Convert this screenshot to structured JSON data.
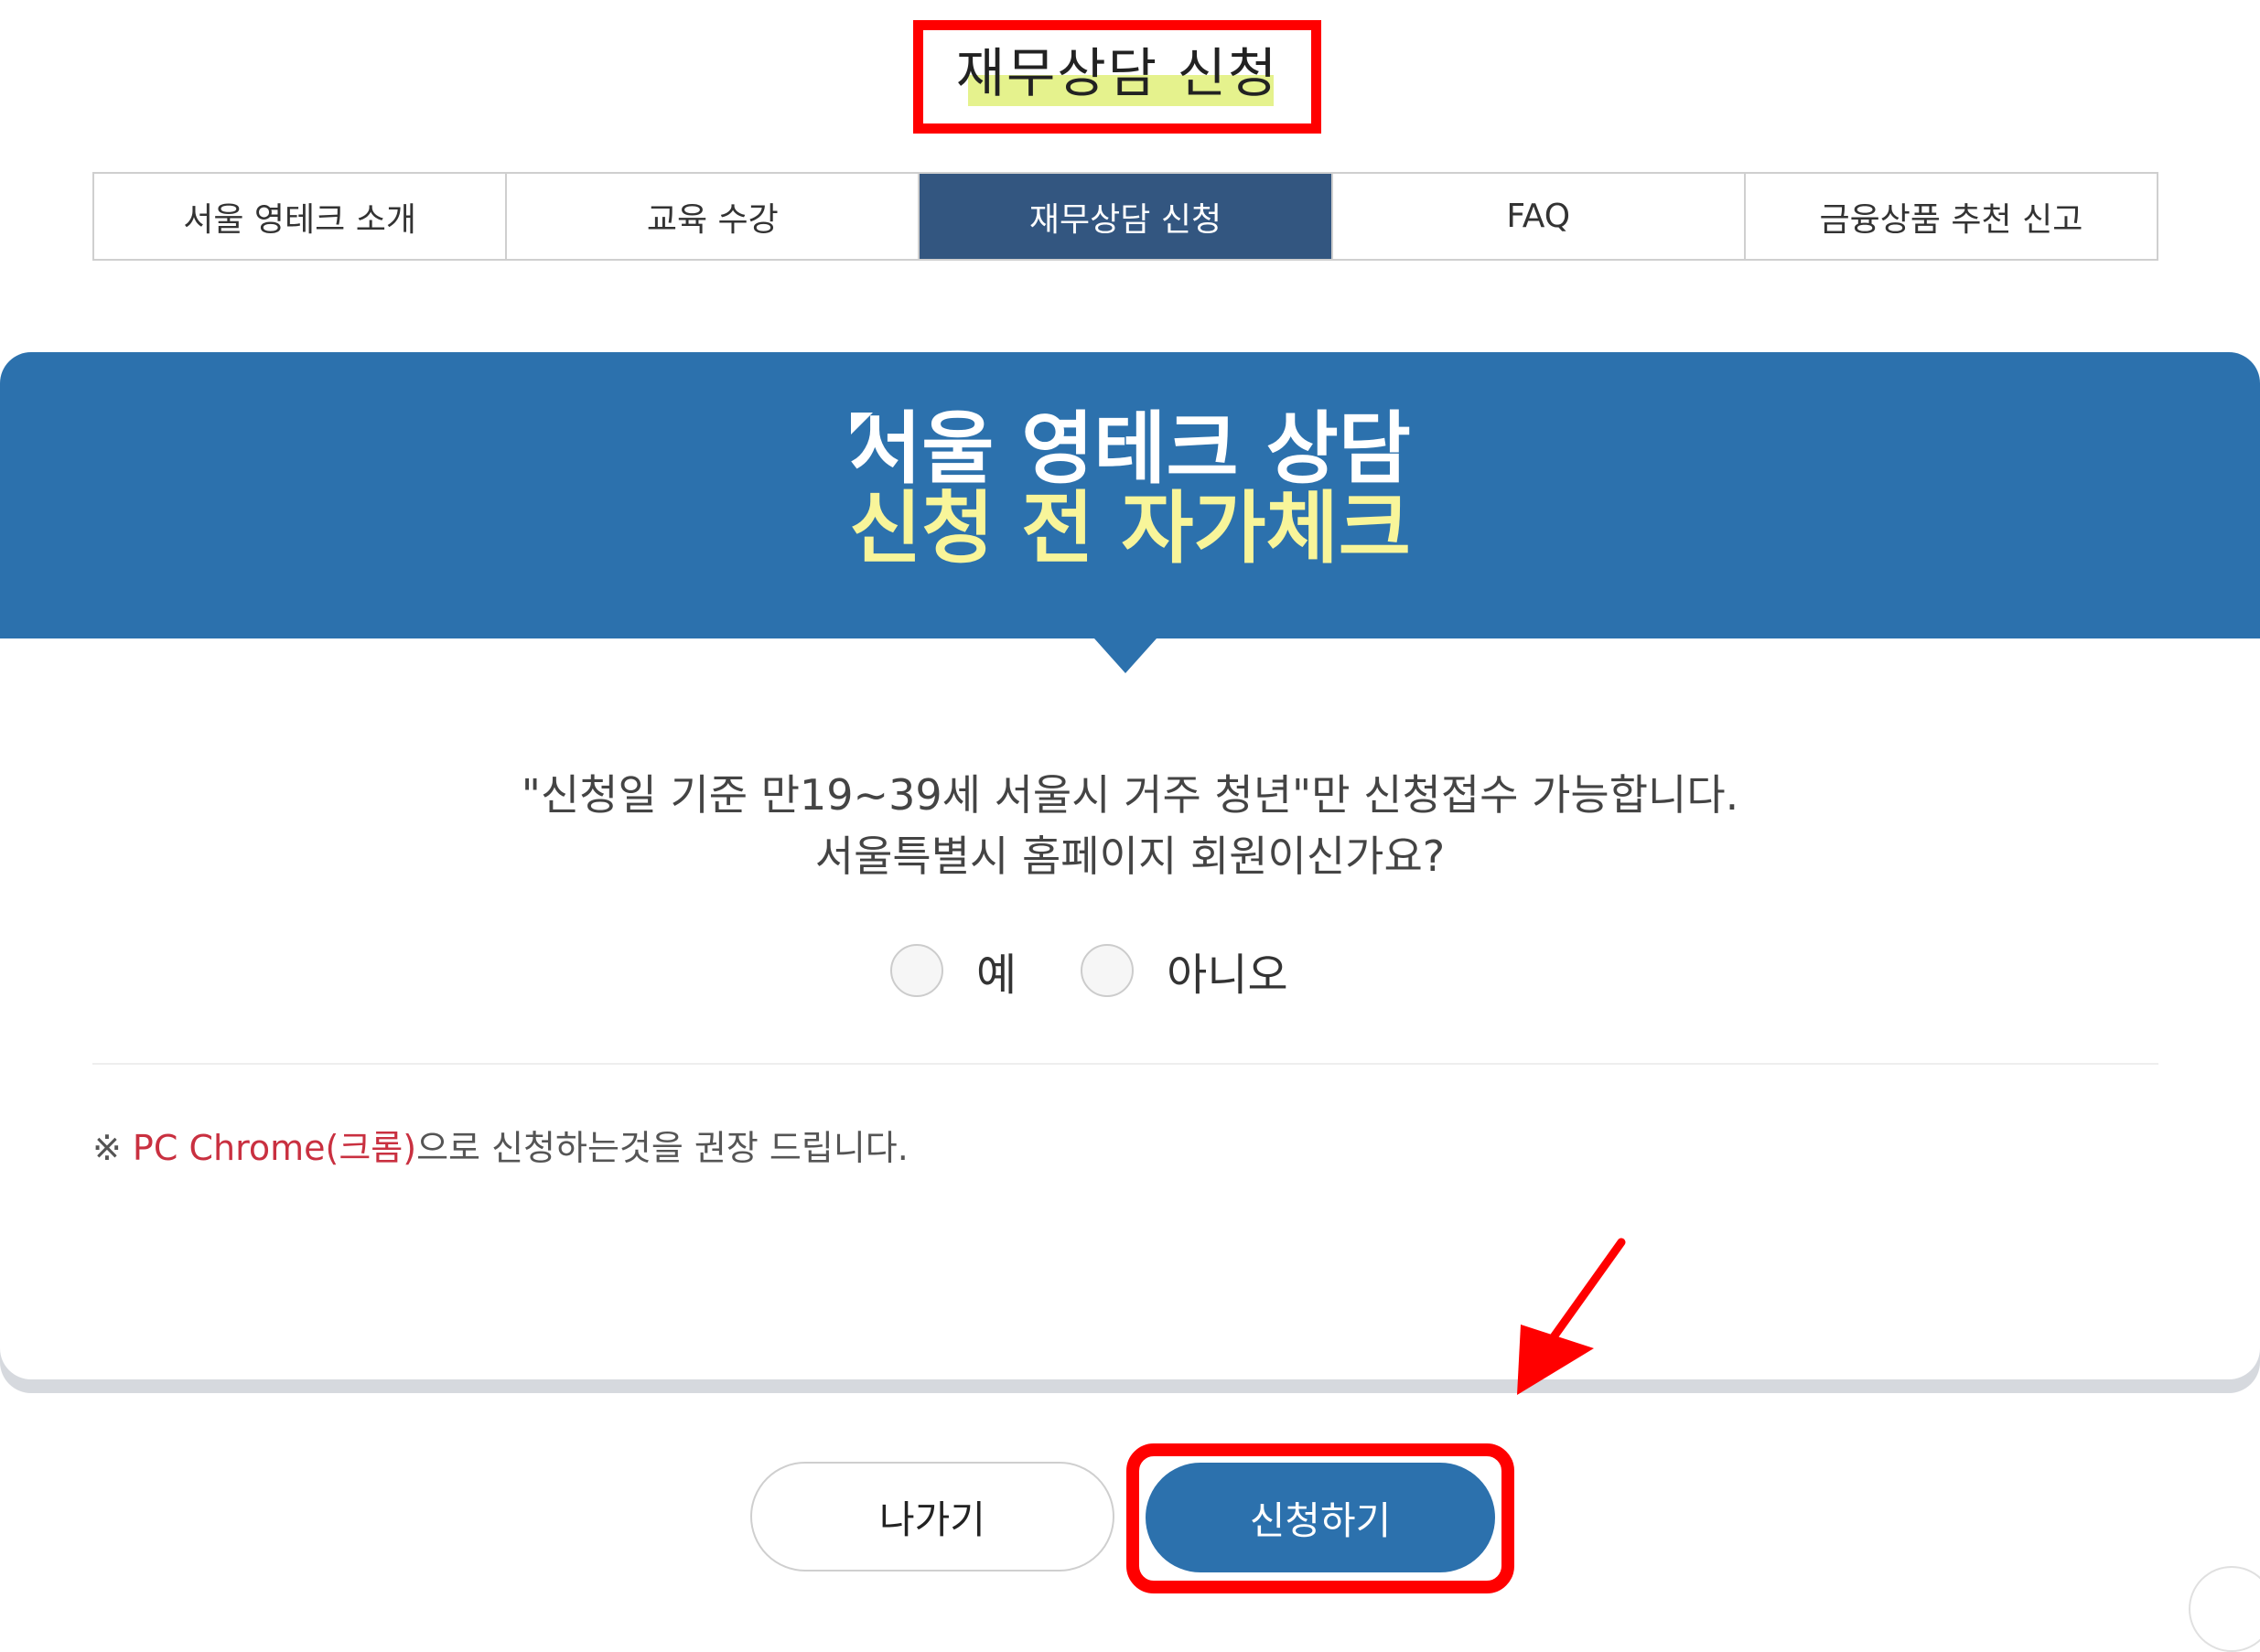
{
  "page_title": "재무상담 신청",
  "tabs": [
    {
      "label": "서울 영테크 소개"
    },
    {
      "label": "교육 수강"
    },
    {
      "label": "재무상담 신청"
    },
    {
      "label": "FAQ"
    },
    {
      "label": "금융상품 추천 신고"
    }
  ],
  "banner": {
    "line1": "서울 영테크 상담",
    "line2": "신청 전 자가체크",
    "bg_color": "#2c71ad",
    "highlight_color": "#f8f59a"
  },
  "question": {
    "line1": "\"신청일 기준 만19~39세 서울시 거주 청년\"만 신청접수 가능합니다.",
    "line2": "서울특별시 홈페이지 회원이신가요?"
  },
  "options": {
    "yes": "예",
    "no": "아니오"
  },
  "note": {
    "prefix": "※ ",
    "highlight": "PC Chrome(크롬)",
    "suffix": "으로 신청하는것을 권장 드립니다.",
    "highlight_color": "#c93040"
  },
  "buttons": {
    "exit": "나가기",
    "apply": "신청하기"
  },
  "annotation_color": "#ff0000"
}
